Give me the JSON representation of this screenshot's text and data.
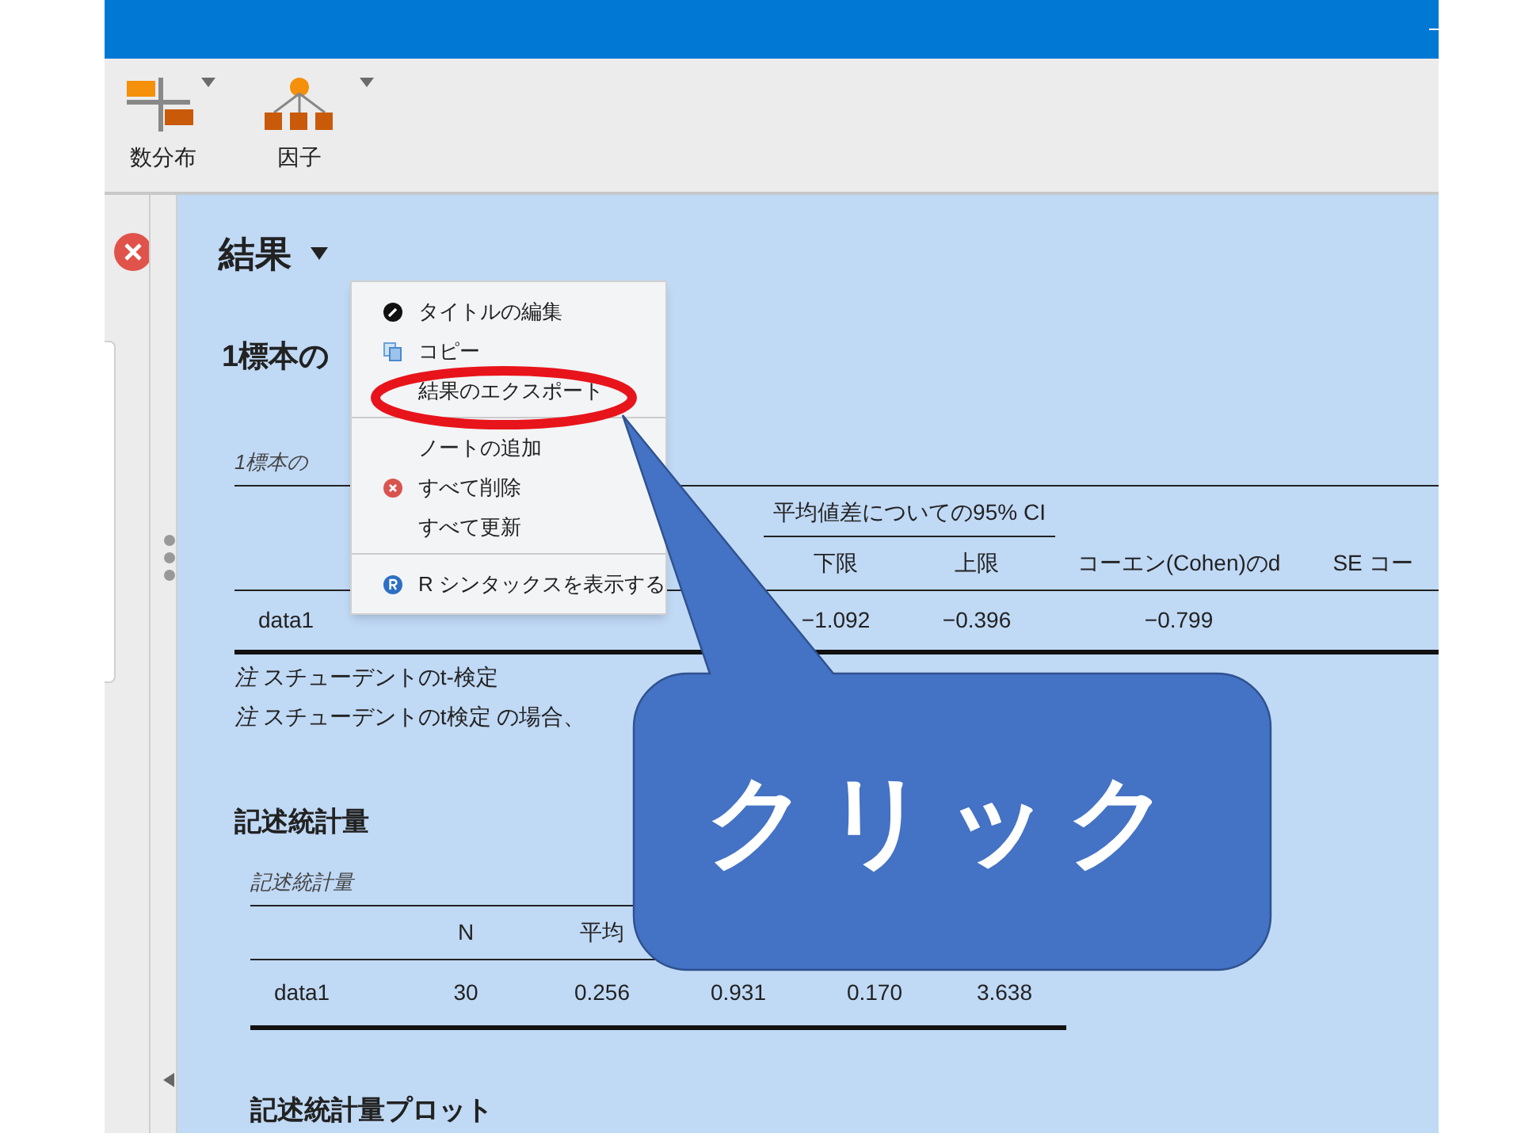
{
  "toolbar": [
    {
      "label": "数分布",
      "kind": "distribution"
    },
    {
      "label": "因子",
      "kind": "factor"
    }
  ],
  "results": {
    "title": "結果",
    "sections": [
      {
        "heading": "1標本の",
        "table": {
          "title": "1標本の",
          "group_header": "平均値差についての95% CI",
          "columns": [
            "下限",
            "上限",
            "コーエン(Cohen)のd",
            "SE コー"
          ],
          "rows": [
            {
              "label": "data1",
              "cells": [
                "−1.092",
                "−0.396",
                "−0.799",
                ""
              ]
            }
          ],
          "notes": [
            {
              "prefix": "注",
              "text": "スチューデントのt-検定"
            },
            {
              "prefix": "注",
              "text": "スチューデントのt検定 の場合、"
            }
          ]
        }
      },
      {
        "heading": "記述統計量",
        "table": {
          "title": "記述統計量",
          "columns": [
            "N",
            "平均",
            "",
            "",
            "",
            ""
          ],
          "rows": [
            {
              "label": "data1",
              "cells": [
                "30",
                "0.256",
                "0.931",
                "0.170",
                "3.638"
              ]
            }
          ]
        }
      },
      {
        "heading": "記述統計量プロット"
      }
    ]
  },
  "context_menu": {
    "groups": [
      [
        {
          "label": "タイトルの編集",
          "kind": "edit"
        },
        {
          "label": "コピー",
          "kind": "copy"
        },
        {
          "label": "結果のエクスポート",
          "kind": "plain",
          "highlighted": true
        }
      ],
      [
        {
          "label": "ノートの追加",
          "kind": "plain"
        },
        {
          "label": "すべて削除",
          "kind": "delete"
        },
        {
          "label": "すべて更新",
          "kind": "plain"
        }
      ],
      [
        {
          "label": "R シンタックスを表示する",
          "kind": "syntax"
        }
      ]
    ]
  },
  "callout": {
    "text": "クリック"
  }
}
